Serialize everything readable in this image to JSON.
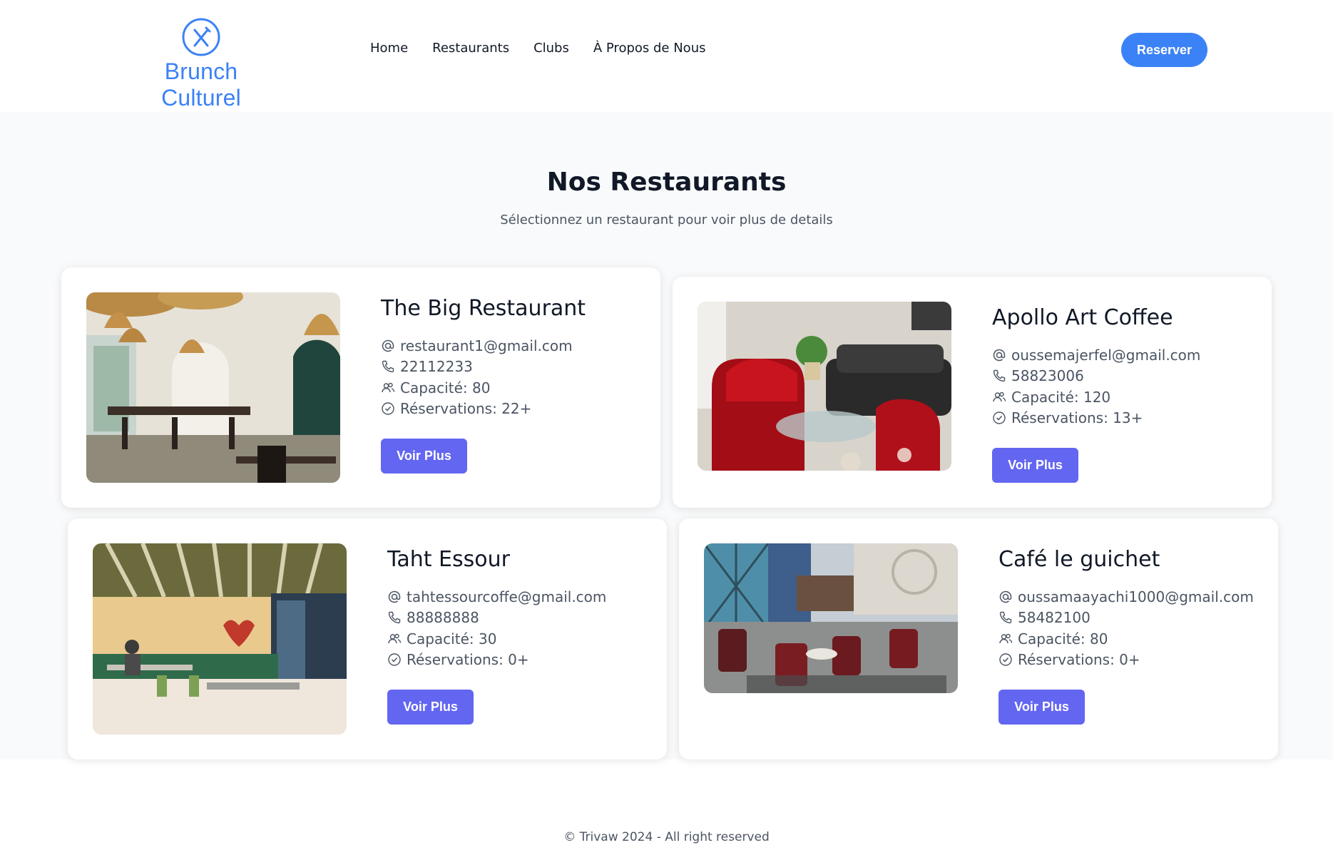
{
  "brand": {
    "name": "Brunch Culturel",
    "icon": "fork-knife-icon",
    "color": "#3b82f6"
  },
  "nav": {
    "items": [
      "Home",
      "Restaurants",
      "Clubs",
      "À Propos de Nous"
    ]
  },
  "header": {
    "reserve_label": "Reserver"
  },
  "main": {
    "title": "Nos Restaurants",
    "subtitle": "Sélectionnez un restaurant pour voir plus de details"
  },
  "restaurants": [
    {
      "name": "The Big Restaurant",
      "email": "restaurant1@gmail.com",
      "phone": "22112233",
      "capacity": "Capacité: 80",
      "reservations": "Réservations: 22+",
      "button": "Voir Plus"
    },
    {
      "name": "Apollo Art Coffee",
      "email": "oussemajerfel@gmail.com",
      "phone": "58823006",
      "capacity": "Capacité: 120",
      "reservations": "Réservations: 13+",
      "button": "Voir Plus"
    },
    {
      "name": "Taht Essour",
      "email": "tahtessourcoffe@gmail.com",
      "phone": "88888888",
      "capacity": "Capacité: 30",
      "reservations": "Réservations: 0+",
      "button": "Voir Plus"
    },
    {
      "name": "Café le guichet",
      "email": "oussamaayachi1000@gmail.com",
      "phone": "58482100",
      "capacity": "Capacité: 80",
      "reservations": "Réservations: 0+",
      "button": "Voir Plus"
    }
  ],
  "icons": {
    "email": "at-icon",
    "phone": "phone-icon",
    "capacity": "users-icon",
    "reservations": "check-circle-icon"
  },
  "colors": {
    "primary": "#3b82f6",
    "button": "#6366f1",
    "background": "#f9fafb"
  },
  "footer": {
    "text": "© Trivaw 2024 - All right reserved"
  }
}
